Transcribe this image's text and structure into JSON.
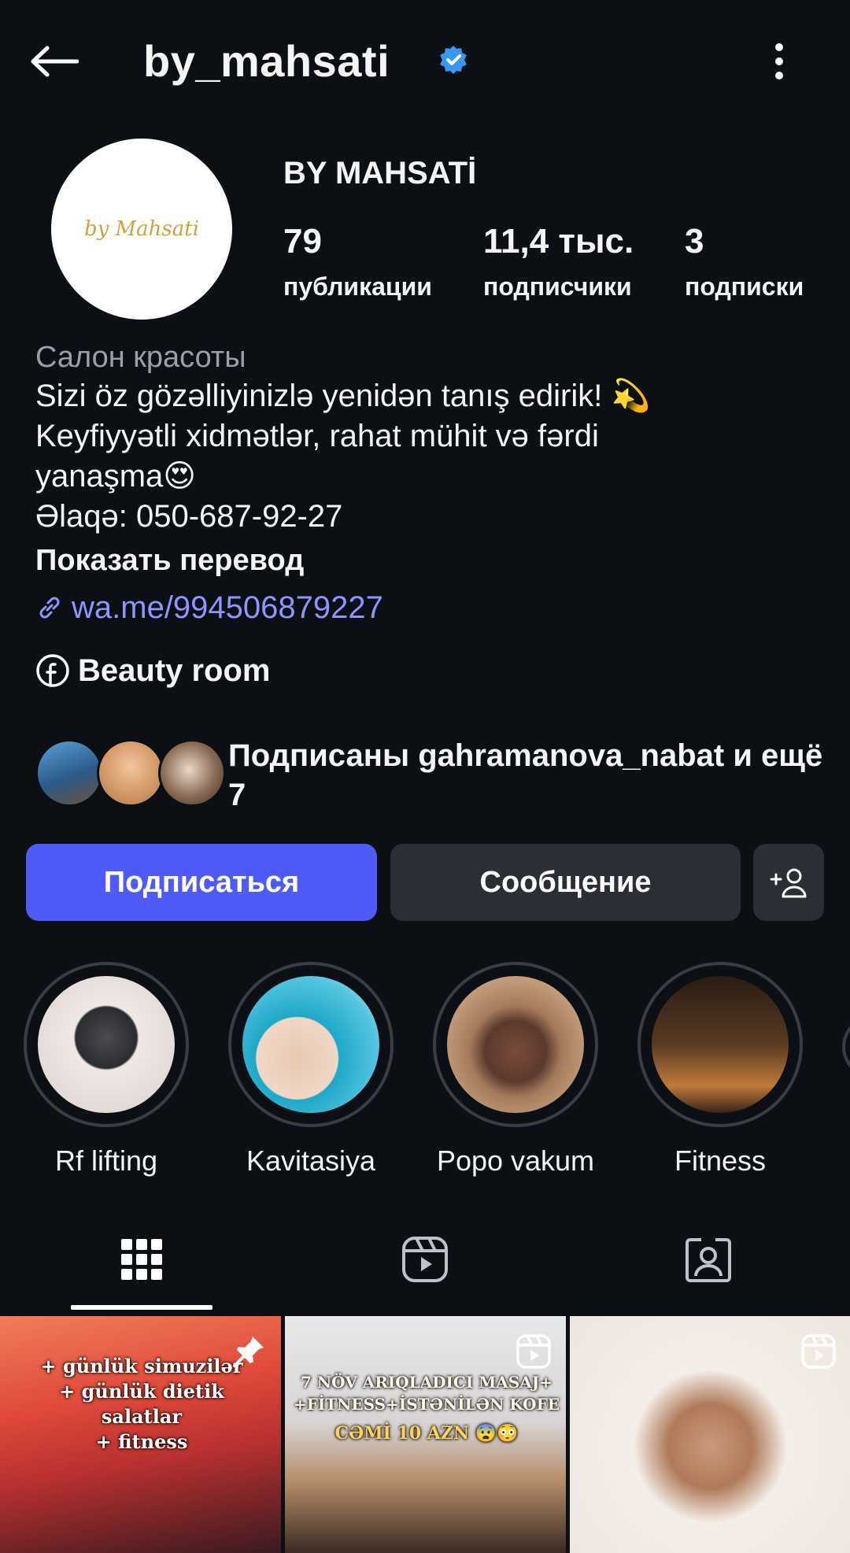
{
  "header": {
    "username": "by_mahsati"
  },
  "profile": {
    "avatar_text": "by Mahsati",
    "display_name": "BY MAHSATİ",
    "stats": {
      "posts": {
        "value": "79",
        "label": "публикации"
      },
      "followers": {
        "value": "11,4 тыс.",
        "label": "подписчики"
      },
      "following": {
        "value": "3",
        "label": "подписки"
      }
    },
    "category": "Салон красоты",
    "bio_lines": [
      "Sizi öz gözəlliyinizlə yenidən tanış edirik! 💫",
      "Keyfiyyətli xidmətlər, rahat mühit və fərdi",
      "yanaşma😍",
      "Əlaqə: 050-687-92-27"
    ],
    "translate_label": "Показать перевод",
    "link": "wa.me/994506879227",
    "facebook_label": "Beauty room",
    "followed_by": "Подписаны gahramanova_nabat и ещё 7"
  },
  "actions": {
    "follow_label": "Подписаться",
    "message_label": "Сообщение"
  },
  "highlights": [
    {
      "label": "Rf lifting"
    },
    {
      "label": "Kavitasiya"
    },
    {
      "label": "Popo vakum"
    },
    {
      "label": "Fitness"
    }
  ],
  "posts": [
    {
      "caption": "+ günlük simuzilər\n+ günlük dietik salatlar\n+ fitness",
      "icon": "pin-icon"
    },
    {
      "caption": "7 NÖV ARIQLADICI MASAJ+\n+FİTNESS+İSTƏNİLƏN KOFE",
      "caption2": "CƏMİ 10 AZN 😨😳",
      "icon": "reels-icon"
    },
    {
      "caption": "",
      "icon": "reels-icon"
    }
  ],
  "colors": {
    "background": "#0c0f14",
    "accent": "#4f5bf8",
    "link": "#8e95ff",
    "verified": "#3897f0"
  }
}
